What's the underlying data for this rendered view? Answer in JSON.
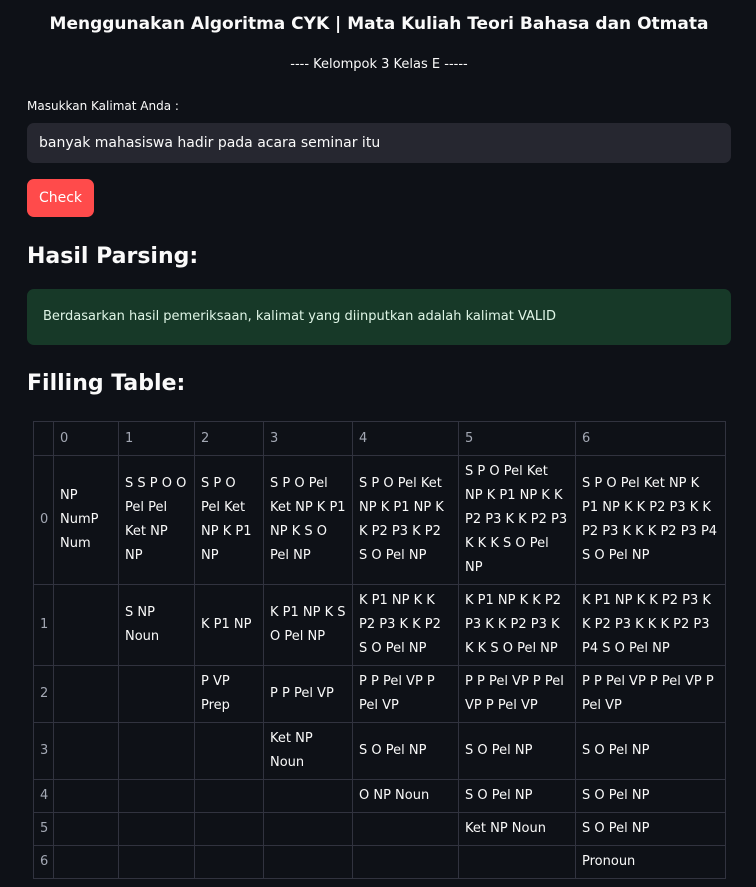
{
  "header": {
    "title": "Menggunakan Algoritma CYK | Mata Kuliah Teori Bahasa dan Otmata",
    "subtitle": "---- Kelompok 3 Kelas E -----"
  },
  "input": {
    "label": "Masukkan Kalimat Anda :",
    "value": "banyak mahasiswa hadir pada acara seminar itu"
  },
  "check_button": {
    "label": "Check"
  },
  "parsing": {
    "heading": "Hasil Parsing:",
    "message": "Berdasarkan hasil pemeriksaan, kalimat yang diinputkan adalah kalimat VALID",
    "accent": "#173928"
  },
  "filling_table": {
    "heading": "Filling Table:",
    "columns": [
      "0",
      "1",
      "2",
      "3",
      "4",
      "5",
      "6"
    ],
    "rows": [
      {
        "index": "0",
        "cells": [
          "NP NumP Num",
          "S S P O O Pel Pel Ket NP NP",
          "S P O Pel Ket NP K P1 NP",
          "S P O Pel Ket NP K P1 NP K S O Pel NP",
          "S P O Pel Ket NP K P1 NP K K P2 P3 K P2 S O Pel NP",
          "S P O Pel Ket NP K P1 NP K K P2 P3 K K P2 P3 K K K S O Pel NP",
          "S P O Pel Ket NP K P1 NP K K P2 P3 K K P2 P3 K K K P2 P3 P4 S O Pel NP"
        ]
      },
      {
        "index": "1",
        "cells": [
          "",
          "S NP Noun",
          "K P1 NP",
          "K P1 NP K S O Pel NP",
          "K P1 NP K K P2 P3 K K P2 S O Pel NP",
          "K P1 NP K K P2 P3 K K P2 P3 K K K S O Pel NP",
          "K P1 NP K K P2 P3 K K P2 P3 K K K P2 P3 P4 S O Pel NP"
        ]
      },
      {
        "index": "2",
        "cells": [
          "",
          "",
          "P VP Prep",
          "P P Pel VP",
          "P P Pel VP P Pel VP",
          "P P Pel VP P Pel VP P Pel VP",
          "P P Pel VP P Pel VP P Pel VP"
        ]
      },
      {
        "index": "3",
        "cells": [
          "",
          "",
          "",
          "Ket NP Noun",
          "S O Pel NP",
          "S O Pel NP",
          "S O Pel NP"
        ]
      },
      {
        "index": "4",
        "cells": [
          "",
          "",
          "",
          "",
          "O NP Noun",
          "S O Pel NP",
          "S O Pel NP"
        ]
      },
      {
        "index": "5",
        "cells": [
          "",
          "",
          "",
          "",
          "",
          "Ket NP Noun",
          "S O Pel NP"
        ]
      },
      {
        "index": "6",
        "cells": [
          "",
          "",
          "",
          "",
          "",
          "",
          "Pronoun"
        ]
      }
    ]
  },
  "colors": {
    "background": "#0e1117",
    "button": "#ff4b4b",
    "input_bg": "#262730",
    "success_bg": "#173928"
  }
}
